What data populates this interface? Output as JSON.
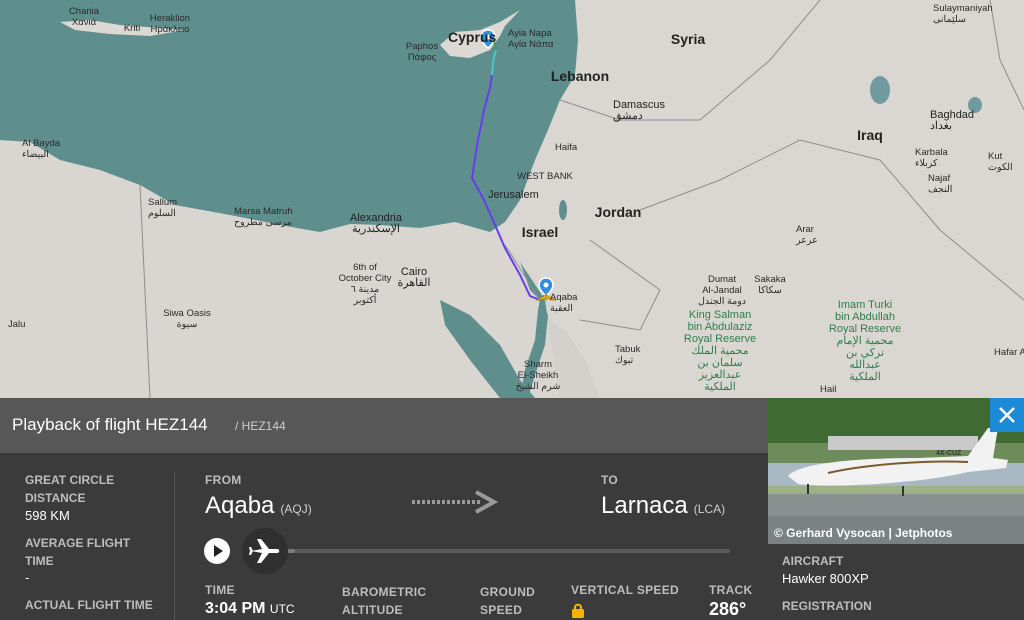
{
  "map": {
    "labels": {
      "chania": "Chania\nΧανιά",
      "heraklion": "Heraklion\nΗράκλειο",
      "kriti": "Kriti",
      "cyprus": "Cyprus",
      "ayia_napa": "Ayia Napa\nΑγία Νάπα",
      "paphos": "Paphos\nΠάφος",
      "syria": "Syria",
      "lebanon": "Lebanon",
      "damascus": "Damascus\nدمشق",
      "iraq": "Iraq",
      "baghdad": "Baghdad\nبغداد",
      "karbala": "Karbala\nكربلاء",
      "najaf": "Najaf\nالنجف",
      "kut": "Kut\nالكوت",
      "sulaymaniyah": "Sulaymaniyah\nسلێمانی",
      "haifa": "Haifa",
      "west_bank": "WEST BANK",
      "jerusalem": "Jerusalem",
      "jordan": "Jordan",
      "israel": "Israel",
      "arar": "Arar\nعرعر",
      "al_bayda": "Al Bayda\nالبيضاء",
      "sallum": "Sallum\nالسلوم",
      "marsa_matruh": "Marsa Matruh\nمرسى مطروح",
      "alexandria": "Alexandria\nالإسكندرية",
      "october": "6th of\nOctober City\nمدينة ٦\nأكتوبر",
      "cairo": "Cairo\nالقاهرة",
      "siwa": "Siwa Oasis\nسيوة",
      "jalu": "Jalu",
      "aqaba": "Aqaba\nالعقبة",
      "sharm": "Sharm\nEl-Sheikh\nشرم الشيخ",
      "tabuk": "Tabuk\nتبوك",
      "dumat": "Dumat\nAl-Jandal\nدومة الجندل",
      "sakaka": "Sakaka\nسكاكا",
      "king_salman": "King Salman\nbin Abdulaziz\nRoyal Reserve\nمحمية الملك\nسلمان بن\nعبدالعزيز\nالملكية",
      "imam_turki": "Imam Turki\nbin Abdullah\nRoyal Reserve\nمحمية الإمام\nتركي بن\nعبدالله\nالملكية",
      "hafar": "Hafar A",
      "hail": "Hail"
    },
    "colors": {
      "sea": "#5e8f8d",
      "land": "#d8d6d2",
      "route": "#6a3cf0",
      "route_cyan": "#45c8d0",
      "route_green": "#3aa05a"
    }
  },
  "panel": {
    "title": "Playback of flight HEZ144",
    "title_sub": "/ HEZ144",
    "great_circle_label": "GREAT CIRCLE DISTANCE",
    "great_circle_value": "598 KM",
    "avg_time_label": "AVERAGE FLIGHT TIME",
    "avg_time_value": "-",
    "actual_time_label": "ACTUAL FLIGHT TIME",
    "from_label": "FROM",
    "from_city": "Aqaba",
    "from_code": "(AQJ)",
    "to_label": "TO",
    "to_city": "Larnaca",
    "to_code": "(LCA)",
    "progress": 0.02,
    "time_label": "TIME",
    "time_value": "3:04 PM",
    "time_unit": "UTC",
    "baro_label": "BAROMETRIC ALTITUDE",
    "gs_label": "GROUND SPEED",
    "vs_label": "VERTICAL SPEED",
    "track_label": "TRACK",
    "track_value": "286°"
  },
  "aircraft": {
    "photo_credit": "© Gerhard Vysocan | Jetphotos",
    "registration_on_tail": "4X-CUZ",
    "aircraft_label": "AIRCRAFT",
    "aircraft_value": "Hawker 800XP",
    "registration_label": "REGISTRATION",
    "close_icon": "close-icon"
  }
}
